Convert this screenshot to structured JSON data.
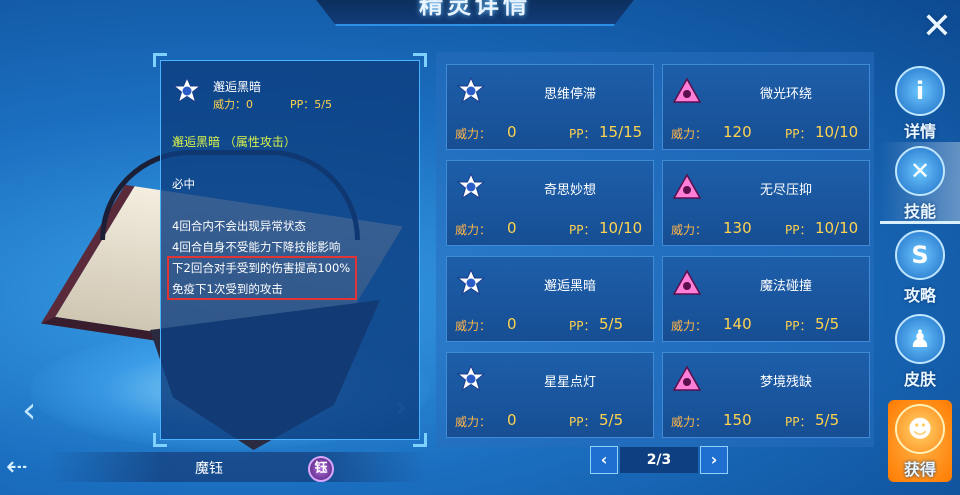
{
  "header": {
    "title": "精灵详情",
    "close_label": "✕"
  },
  "detail": {
    "skill_name": "邂逅黑暗",
    "power_label": "威力：0",
    "pp_label": "PP：5/5",
    "subtitle": "邂逅黑暗 （属性攻击）",
    "lines": [
      "必中",
      "4回合内不会出现异常状态",
      "4回合自身不受能力下降技能影响",
      "下2回合对手受到的伤害提高100%",
      "免疫下1次受到的攻击"
    ]
  },
  "pet": {
    "name": "魔钰",
    "element_glyph": "钰"
  },
  "skills": [
    {
      "name": "思维停滞",
      "power_label": "威力：",
      "power": "0",
      "pp_label": "PP：",
      "pp": "15/15",
      "icon": "star-icon"
    },
    {
      "name": "微光环绕",
      "power_label": "威力：",
      "power": "120",
      "pp_label": "PP：",
      "pp": "10/10",
      "icon": "triangle-eye-icon"
    },
    {
      "name": "奇思妙想",
      "power_label": "威力：",
      "power": "0",
      "pp_label": "PP：",
      "pp": "10/10",
      "icon": "star-icon"
    },
    {
      "name": "无尽压抑",
      "power_label": "威力：",
      "power": "130",
      "pp_label": "PP：",
      "pp": "10/10",
      "icon": "triangle-eye-icon"
    },
    {
      "name": "邂逅黑暗",
      "power_label": "威力：",
      "power": "0",
      "pp_label": "PP：",
      "pp": "5/5",
      "icon": "star-icon"
    },
    {
      "name": "魔法碰撞",
      "power_label": "威力：",
      "power": "140",
      "pp_label": "PP：",
      "pp": "5/5",
      "icon": "triangle-eye-icon"
    },
    {
      "name": "星星点灯",
      "power_label": "威力：",
      "power": "0",
      "pp_label": "PP：",
      "pp": "5/5",
      "icon": "star-icon"
    },
    {
      "name": "梦境残缺",
      "power_label": "威力：",
      "power": "150",
      "pp_label": "PP：",
      "pp": "5/5",
      "icon": "triangle-eye-icon"
    }
  ],
  "pager": {
    "prev": "‹",
    "next": "›",
    "page": "2/3"
  },
  "tabs": [
    {
      "label": "详情",
      "glyph": "i"
    },
    {
      "label": "技能",
      "glyph": "✕"
    },
    {
      "label": "攻略",
      "glyph": "S"
    },
    {
      "label": "皮肤",
      "glyph": "♟"
    },
    {
      "label": "获得",
      "glyph": "☻"
    }
  ],
  "colors": {
    "accent": "#4ab3ff",
    "value": "#ffd34d",
    "highlight": "#e23434",
    "subtitle": "#d8f14b"
  }
}
